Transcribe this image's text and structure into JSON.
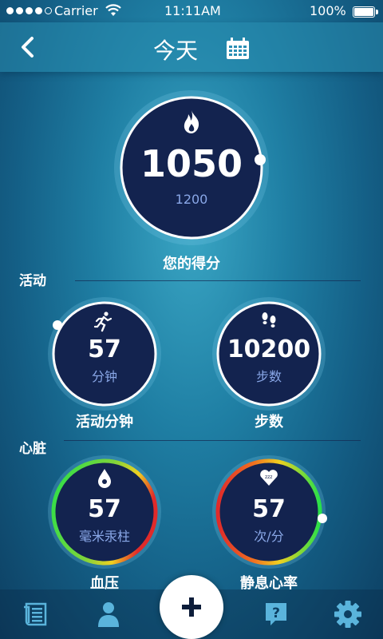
{
  "status_bar": {
    "carrier": "Carrier",
    "time": "11:11AM",
    "battery": "100%"
  },
  "header": {
    "title": "今天",
    "calendar_icon": "calendar-icon",
    "back_icon": "chevron-left-icon"
  },
  "score": {
    "value": "1050",
    "goal": "1200",
    "label": "您的得分",
    "icon": "flame-icon",
    "progress": 0.875
  },
  "activity_section": {
    "label": "活动",
    "minutes": {
      "value": "57",
      "unit": "分钟",
      "caption": "活动分钟",
      "icon": "running-icon"
    },
    "steps": {
      "value": "10200",
      "unit": "步数",
      "caption": "步数",
      "icon": "footprints-icon"
    }
  },
  "heart_section": {
    "label": "心脏",
    "blood_pressure": {
      "value": "57",
      "unit": "毫米汞柱",
      "caption": "血压",
      "icon": "blood-drop-icon"
    },
    "resting_hr": {
      "value": "57",
      "unit": "次/分",
      "caption": "静息心率",
      "icon": "sleeping-heart-icon"
    }
  },
  "nav": {
    "items": [
      "journal-icon",
      "profile-icon",
      "add-icon",
      "help-icon",
      "settings-icon"
    ]
  },
  "colors": {
    "gauge_fill": "#13234f",
    "accent": "#8aa8e8"
  }
}
